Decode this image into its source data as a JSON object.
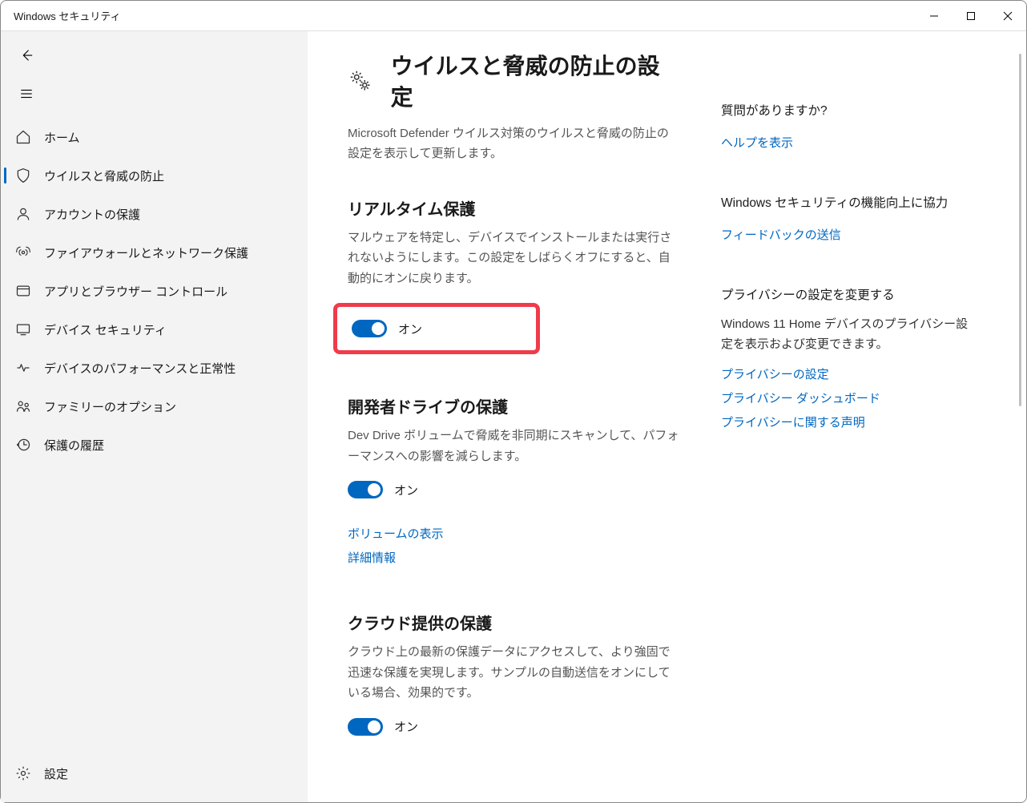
{
  "window": {
    "title": "Windows セキュリティ"
  },
  "sidebar": {
    "items": [
      {
        "id": "home",
        "label": "ホーム"
      },
      {
        "id": "virus",
        "label": "ウイルスと脅威の防止",
        "active": true
      },
      {
        "id": "account",
        "label": "アカウントの保護"
      },
      {
        "id": "firewall",
        "label": "ファイアウォールとネットワーク保護"
      },
      {
        "id": "appbrowser",
        "label": "アプリとブラウザー コントロール"
      },
      {
        "id": "device",
        "label": "デバイス セキュリティ"
      },
      {
        "id": "perf",
        "label": "デバイスのパフォーマンスと正常性"
      },
      {
        "id": "family",
        "label": "ファミリーのオプション"
      },
      {
        "id": "history",
        "label": "保護の履歴"
      }
    ],
    "settings_label": "設定"
  },
  "page": {
    "title": "ウイルスと脅威の防止の設定",
    "subtitle": "Microsoft Defender ウイルス対策のウイルスと脅威の防止の設定を表示して更新します。"
  },
  "sections": {
    "realtime": {
      "title": "リアルタイム保護",
      "desc": "マルウェアを特定し、デバイスでインストールまたは実行されないようにします。この設定をしばらくオフにすると、自動的にオンに戻ります。",
      "toggle_label": "オン"
    },
    "devdrive": {
      "title": "開発者ドライブの保護",
      "desc": "Dev Drive ボリュームで脅威を非同期にスキャンして、パフォーマンスへの影響を減らします。",
      "toggle_label": "オン",
      "links": {
        "volumes": "ボリュームの表示",
        "more": "詳細情報"
      }
    },
    "cloud": {
      "title": "クラウド提供の保護",
      "desc": "クラウド上の最新の保護データにアクセスして、より強固で迅速な保護を実現します。サンプルの自動送信をオンにしている場合、効果的です。",
      "toggle_label": "オン"
    }
  },
  "right": {
    "help": {
      "heading": "質問がありますか?",
      "link": "ヘルプを表示"
    },
    "feedback": {
      "heading": "Windows セキュリティの機能向上に協力",
      "link": "フィードバックの送信"
    },
    "privacy": {
      "heading": "プライバシーの設定を変更する",
      "sub": "Windows 11 Home デバイスのプライバシー設定を表示および変更できます。",
      "links": {
        "settings": "プライバシーの設定",
        "dashboard": "プライバシー ダッシュボード",
        "statement": "プライバシーに関する声明"
      }
    }
  }
}
